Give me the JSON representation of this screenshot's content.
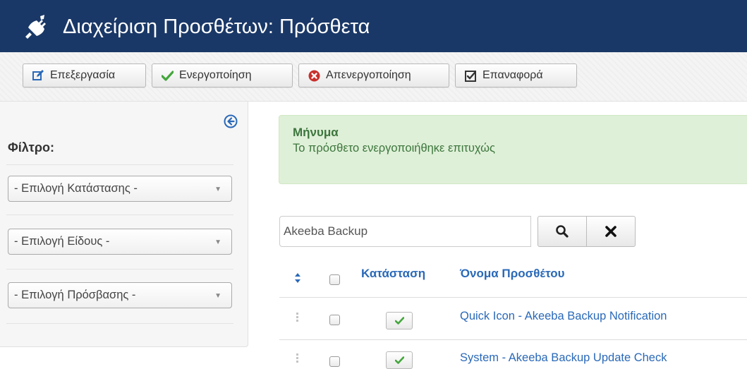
{
  "header": {
    "title": "Διαχείριση Προσθέτων: Πρόσθετα",
    "icon": "plug-icon",
    "background": "#1a3867"
  },
  "toolbar": {
    "edit_label": "Επεξεργασία",
    "enable_label": "Ενεργοποίηση",
    "disable_label": "Απενεργοποίηση",
    "checkin_label": "Επαναφορά"
  },
  "sidebar": {
    "filter_title": "Φίλτρο:",
    "filters": [
      {
        "selected": "- Επιλογή Κατάστασης -"
      },
      {
        "selected": "- Επιλογή Είδους -"
      },
      {
        "selected": "- Επιλογή Πρόσβασης -"
      }
    ]
  },
  "alert": {
    "heading": "Μήνυμα",
    "message": "Το πρόσθετο ενεργοποιήθηκε επιτυχώς",
    "color": "#3c763d",
    "background": "#dff0d8"
  },
  "search": {
    "value": "Akeeba Backup"
  },
  "table": {
    "columns": {
      "status": "Κατάσταση",
      "name": "Όνομα Προσθέτου"
    },
    "rows": [
      {
        "name": "Quick Icon - Akeeba Backup Notification",
        "status": "enabled"
      },
      {
        "name": "System - Akeeba Backup Update Check",
        "status": "enabled"
      }
    ]
  },
  "colors": {
    "link": "#2a69b8",
    "check": "#43a63b",
    "danger": "#c9302c"
  }
}
